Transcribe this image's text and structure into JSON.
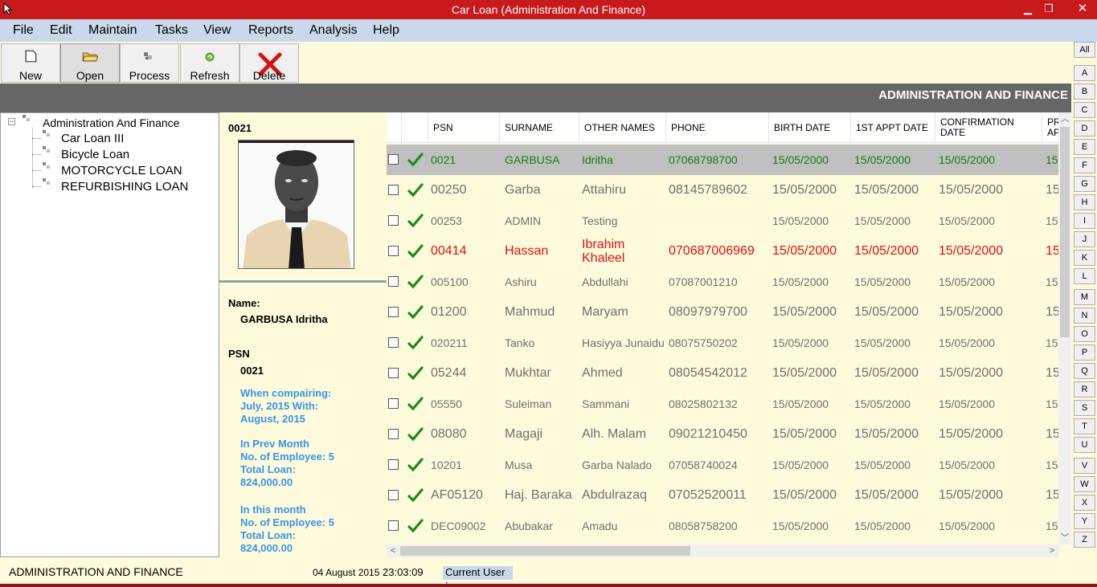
{
  "window": {
    "title": "Car Loan (Administration And Finance)",
    "minimize": "▁",
    "restore": "❐",
    "close": "✕"
  },
  "menu": [
    "File",
    "Edit",
    "Maintain",
    "Tasks",
    "View",
    "Reports",
    "Analysis",
    "Help"
  ],
  "toolbar": [
    {
      "label": "New",
      "icon": "new-document-icon"
    },
    {
      "label": "Open",
      "icon": "open-folder-icon"
    },
    {
      "label": "Process",
      "icon": "process-icon"
    },
    {
      "label": "Refresh",
      "icon": "refresh-icon"
    },
    {
      "label": "Delete",
      "icon": "delete-icon"
    }
  ],
  "header_band": "ADMINISTRATION AND FINANCE",
  "tree": {
    "root": "Administration And Finance",
    "children": [
      "Car Loan III",
      "Bicycle Loan",
      "MOTORCYCLE LOAN",
      "REFURBISHING LOAN"
    ]
  },
  "details": {
    "psn_top": "0021",
    "name_label": "Name:",
    "name_value": "GARBUSA Idritha",
    "psn_label": "PSN",
    "psn_value": "0021",
    "compare": [
      "When compairing:",
      "July, 2015 With:",
      "August, 2015"
    ],
    "prev_month": [
      "In Prev Month",
      "No. of Employee:  5",
      "Total Loan:",
      "824,000.00"
    ],
    "this_month": [
      "In this month",
      "No. of Employee:  5",
      "Total Loan:",
      "824,000.00"
    ]
  },
  "grid": {
    "columns": [
      "PSN",
      "SURNAME",
      "OTHER NAMES",
      "PHONE",
      "BIRTH DATE",
      "1ST APPT DATE",
      "CONFIRMATION DATE",
      "PR AP"
    ],
    "rows": [
      {
        "psn": "0021",
        "surname": "GARBUSA",
        "other": "Idritha",
        "phone": "07068798700",
        "birth": "15/05/2000",
        "appt": "15/05/2000",
        "confirm": "15/05/2000",
        "extra": "15",
        "color": "#1a7a1a",
        "size": "s",
        "selected": true
      },
      {
        "psn": "00250",
        "surname": "Garba",
        "other": "Attahiru",
        "phone": "08145789602",
        "birth": "15/05/2000",
        "appt": "15/05/2000",
        "confirm": "15/05/2000",
        "extra": "15",
        "color": "#707070",
        "size": "l",
        "selected": false
      },
      {
        "psn": "00253",
        "surname": "ADMIN",
        "other": "Testing",
        "phone": "",
        "birth": "15/05/2000",
        "appt": "15/05/2000",
        "confirm": "15/05/2000",
        "extra": "15",
        "color": "#707070",
        "size": "s",
        "selected": false
      },
      {
        "psn": "00414",
        "surname": "Hassan",
        "other": "Ibrahim Khaleel",
        "phone": "070687006969",
        "birth": "15/05/2000",
        "appt": "15/05/2000",
        "confirm": "15/05/2000",
        "extra": "15",
        "color": "#e01010",
        "size": "l",
        "selected": false
      },
      {
        "psn": "005100",
        "surname": "Ashiru",
        "other": "Abdullahi",
        "phone": "07087001210",
        "birth": "15/05/2000",
        "appt": "15/05/2000",
        "confirm": "15/05/2000",
        "extra": "15",
        "color": "#707070",
        "size": "s",
        "selected": false
      },
      {
        "psn": "01200",
        "surname": "Mahmud",
        "other": "Maryam",
        "phone": "08097979700",
        "birth": "15/05/2000",
        "appt": "15/05/2000",
        "confirm": "15/05/2000",
        "extra": "15",
        "color": "#707070",
        "size": "l",
        "selected": false
      },
      {
        "psn": "020211",
        "surname": "Tanko",
        "other": "Hasiyya Junaidu",
        "phone": "08075750202",
        "birth": "15/05/2000",
        "appt": "15/05/2000",
        "confirm": "15/05/2000",
        "extra": "15",
        "color": "#707070",
        "size": "s",
        "selected": false
      },
      {
        "psn": "05244",
        "surname": "Mukhtar",
        "other": "Ahmed",
        "phone": "08054542012",
        "birth": "15/05/2000",
        "appt": "15/05/2000",
        "confirm": "15/05/2000",
        "extra": "15",
        "color": "#707070",
        "size": "l",
        "selected": false
      },
      {
        "psn": "05550",
        "surname": "Suleiman",
        "other": "Sammani",
        "phone": "08025802132",
        "birth": "15/05/2000",
        "appt": "15/05/2000",
        "confirm": "15/05/2000",
        "extra": "15",
        "color": "#707070",
        "size": "s",
        "selected": false
      },
      {
        "psn": "08080",
        "surname": "Magaji",
        "other": "Alh. Malam",
        "phone": "09021210450",
        "birth": "15/05/2000",
        "appt": "15/05/2000",
        "confirm": "15/05/2000",
        "extra": "15",
        "color": "#707070",
        "size": "l",
        "selected": false
      },
      {
        "psn": "10201",
        "surname": "Musa",
        "other": "Garba Nalado",
        "phone": "07058740024",
        "birth": "15/05/2000",
        "appt": "15/05/2000",
        "confirm": "15/05/2000",
        "extra": "15",
        "color": "#707070",
        "size": "s",
        "selected": false
      },
      {
        "psn": "AF05120",
        "surname": "Haj. Baraka",
        "other": "Abdulrazaq",
        "phone": "07052520011",
        "birth": "15/05/2000",
        "appt": "15/05/2000",
        "confirm": "15/05/2000",
        "extra": "15",
        "color": "#707070",
        "size": "l",
        "selected": false
      },
      {
        "psn": "DEC09002",
        "surname": "Abubakar",
        "other": "Amadu",
        "phone": "08058758200",
        "birth": "15/05/2000",
        "appt": "15/05/2000",
        "confirm": "15/05/2000",
        "extra": "15",
        "color": "#707070",
        "size": "s",
        "selected": false
      }
    ]
  },
  "alphabet": [
    "All",
    "A",
    "B",
    "C",
    "D",
    "E",
    "F",
    "G",
    "H",
    "I",
    "J",
    "K",
    "L",
    "M",
    "N",
    "O",
    "P",
    "Q",
    "R",
    "S",
    "T",
    "U",
    "V",
    "W",
    "X",
    "Y",
    "Z"
  ],
  "status": {
    "module": "ADMINISTRATION AND FINANCE",
    "date": "04 August 2015",
    "time": "23:03:09",
    "user_label": "Current User :"
  },
  "colors": {
    "titlebar": "#c8191d",
    "menubar": "#c9d8ea",
    "header_band": "#666666",
    "panel_bg": "#fdfbdc",
    "selected_row": "#c0c0c0",
    "blue_text": "#3a93e6"
  }
}
